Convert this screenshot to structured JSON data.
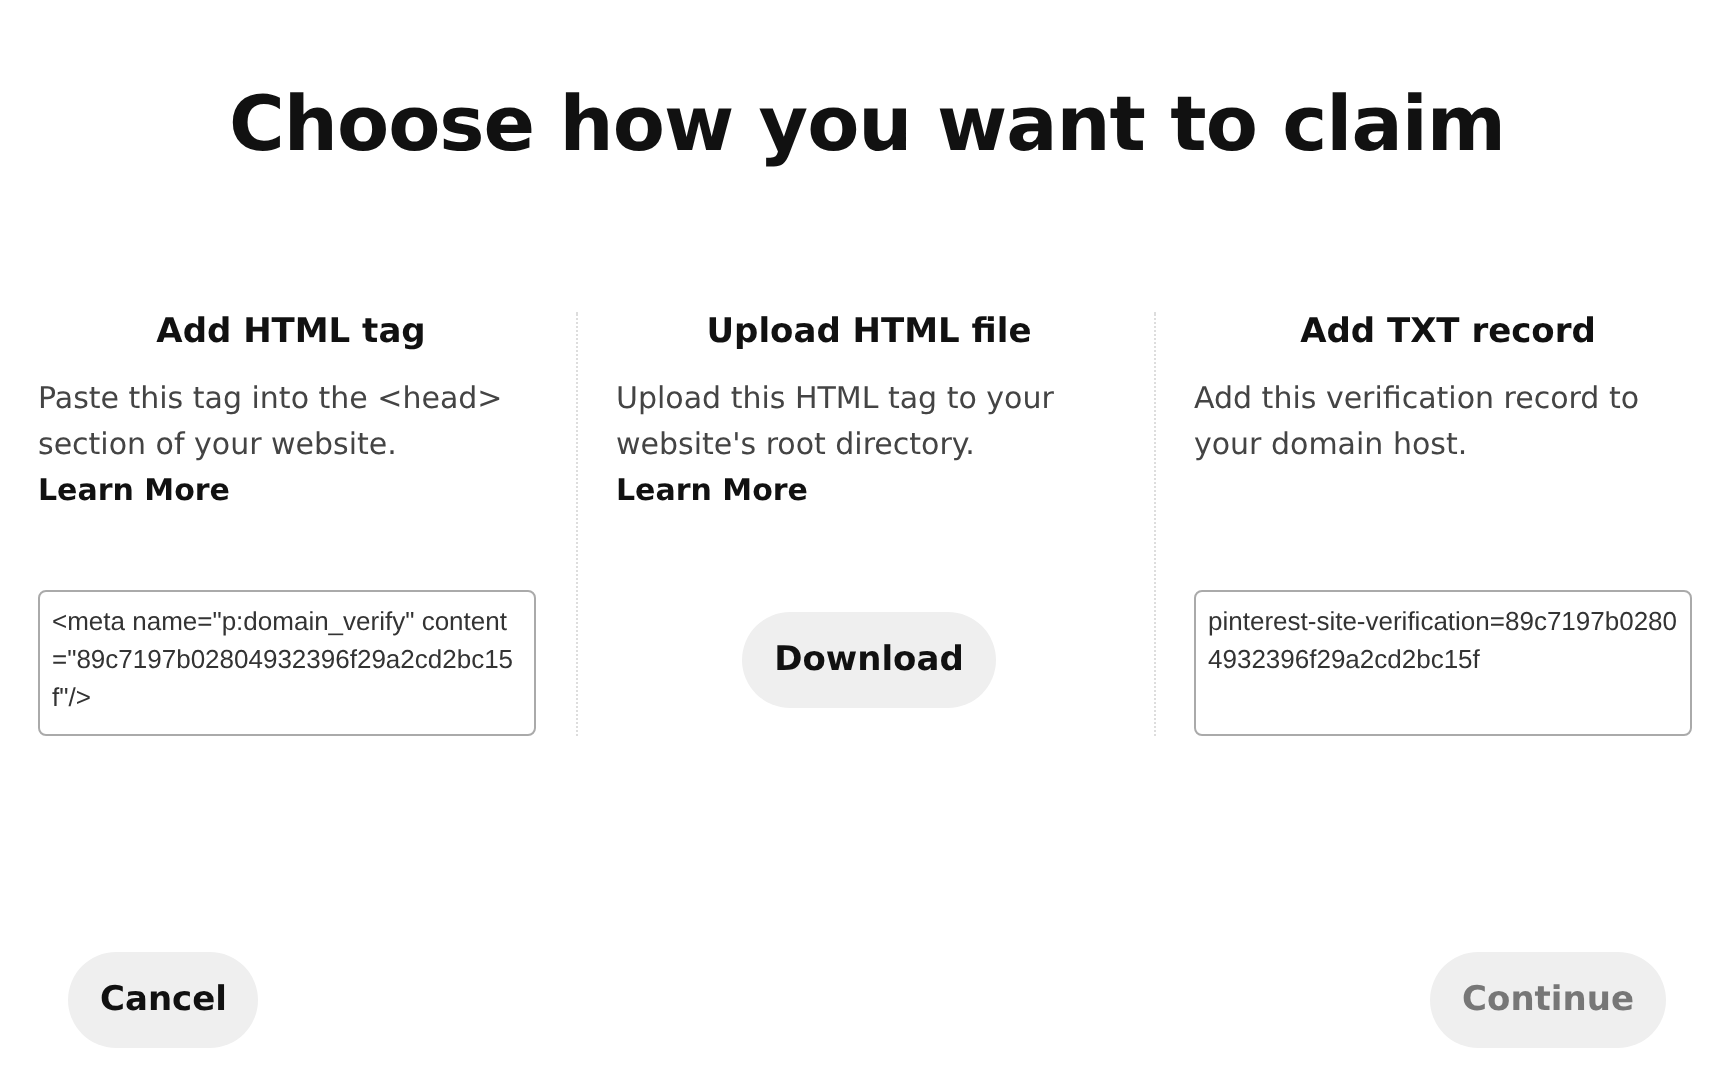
{
  "title": "Choose how you want to claim",
  "options": [
    {
      "kind": "code",
      "heading": "Add HTML tag",
      "description": "Paste this tag into the <head> section of your website.",
      "link": "Learn More",
      "value": "<meta name=\"p:domain_verify\" content=\"89c7197b02804932396f29a2cd2bc15f\"/>"
    },
    {
      "kind": "download",
      "heading": "Upload HTML file",
      "description": "Upload this HTML tag to your website's root directory.",
      "link": "Learn More",
      "button": "Download"
    },
    {
      "kind": "code",
      "heading": "Add TXT record",
      "description": "Add this verification record to your domain host.",
      "value": "pinterest-site-verification=89c7197b02804932396f29a2cd2bc15f"
    }
  ],
  "footer": {
    "cancel": {
      "label": "Cancel",
      "disabled": false
    },
    "continue": {
      "label": "Continue",
      "disabled": true
    }
  }
}
